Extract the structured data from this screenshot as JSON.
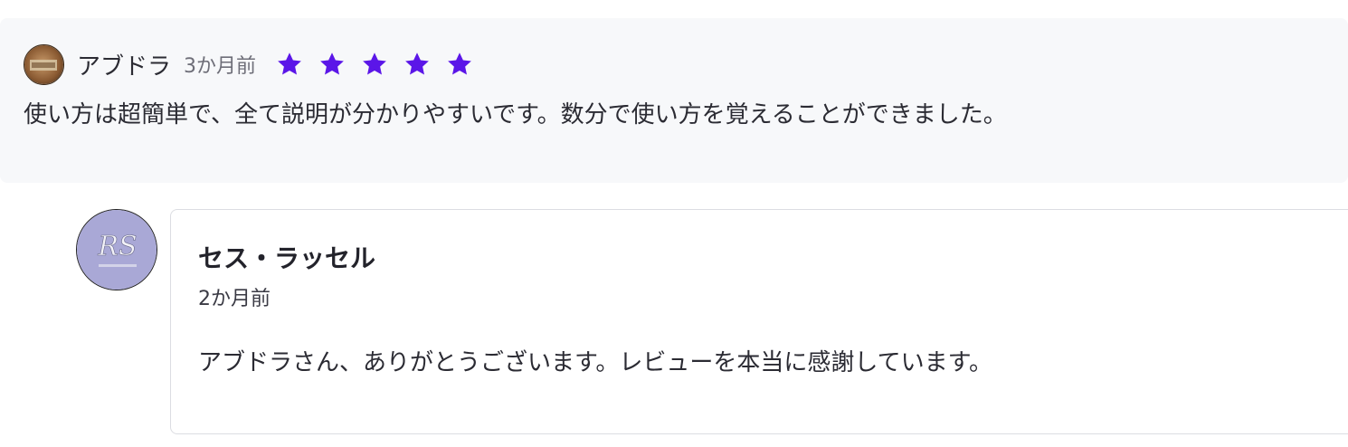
{
  "review": {
    "reviewer_name": "アブドラ",
    "time_ago": "3か月前",
    "rating": 5,
    "star_color": "#5b16e8",
    "text": "使い方は超簡単で、全て説明が分かりやすいです。数分で使い方を覚えることができました。"
  },
  "reply": {
    "author_name": "セス・ラッセル",
    "time_ago": "2か月前",
    "text": "アブドラさん、ありがとうございます。レビューを本当に感謝しています。",
    "avatar_monogram": "RS",
    "avatar_color": "#a9a8d6"
  }
}
